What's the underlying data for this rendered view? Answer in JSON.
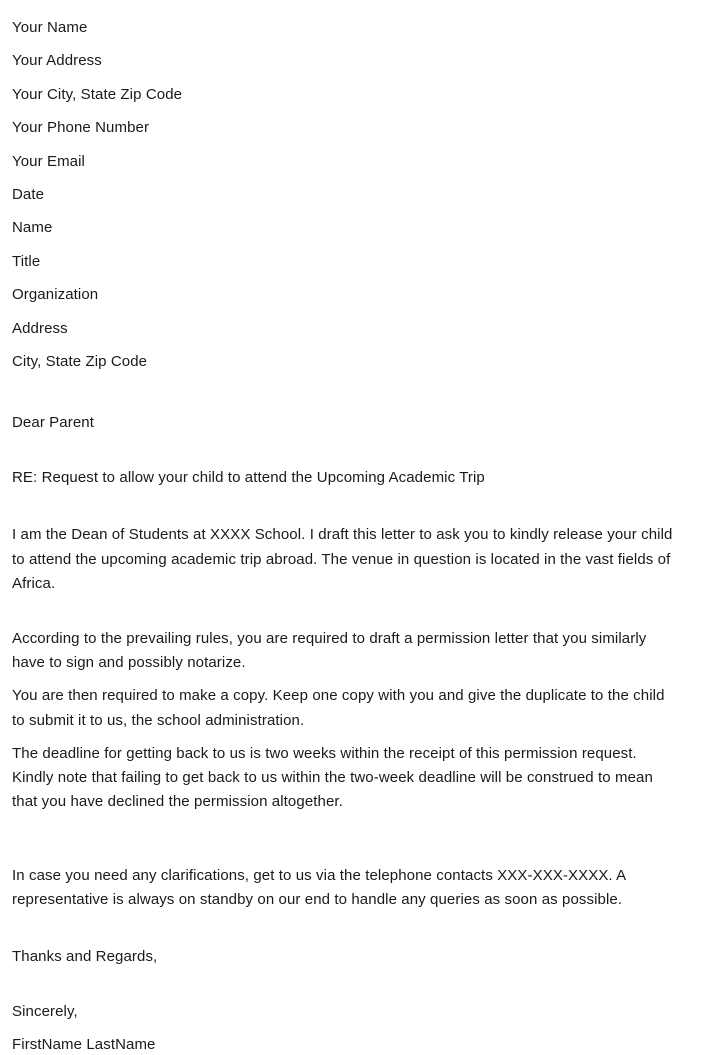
{
  "document": {
    "type": "letter",
    "background_color": "#ffffff",
    "text_color": "#1a1a1a"
  },
  "letterhead": {
    "lines": [
      "Your Name",
      "Your Address",
      "Your City, State Zip Code",
      "Your Phone Number",
      "Your Email",
      "Date",
      "Name",
      "Title",
      "Organization",
      "Address",
      "City, State Zip Code"
    ]
  },
  "salutation": "Dear Parent",
  "subject": "RE: Request to allow your child to attend the Upcoming Academic Trip",
  "body": {
    "paragraphs": [
      "I am the Dean of Students at XXXX School. I draft this letter to ask you to kindly release your child to attend the upcoming academic trip abroad. The venue in question is located in the vast fields of Africa.",
      "According to the prevailing rules, you are required to draft a permission letter that you similarly have to sign and possibly notarize.",
      "You are then required to make a copy. Keep one copy with you and give the duplicate to the child to submit it to us, the school administration.",
      "The deadline for getting back to us is two weeks within the receipt of this permission request. Kindly note that failing to get back to us within the two-week deadline will be construed to mean that you have declined the permission altogether.",
      "In case you need any clarifications, get to us via the telephone contacts XXX-XXX-XXXX. A representative is always on standby on our end to handle any queries as soon as possible."
    ]
  },
  "closing": {
    "thanks": "Thanks and Regards,",
    "sincerely": "Sincerely,",
    "signature_name": "FirstName LastName"
  }
}
